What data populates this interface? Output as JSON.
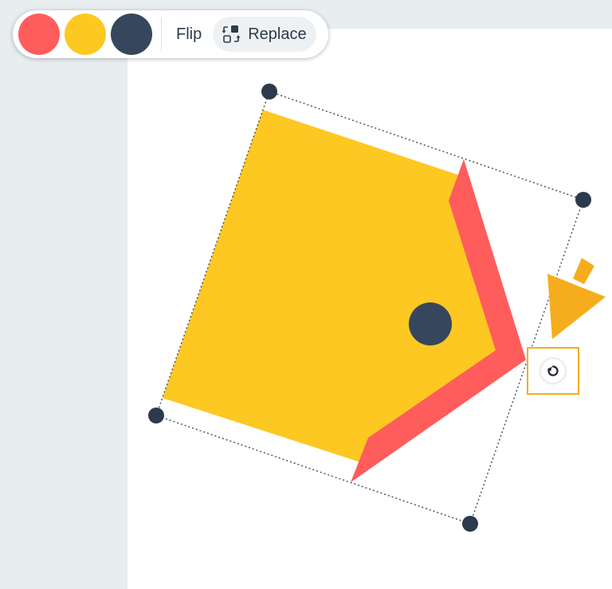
{
  "toolbar": {
    "colors": [
      "#ff5c5c",
      "#fcc821",
      "#36465d"
    ],
    "flip_label": "Flip",
    "replace_label": "Replace",
    "replace_icon": "replace-icon"
  },
  "selection": {
    "shape": "pentagon-pencil",
    "fill_color": "#fcc821",
    "edge_color": "#ff5c5c",
    "dot_color": "#36465d",
    "handle_color": "#2d3a4b",
    "rotate_icon": "rotate-icon",
    "pointer_icon": "arrow-pointer-icon",
    "pointer_color": "#f5ad1d"
  }
}
